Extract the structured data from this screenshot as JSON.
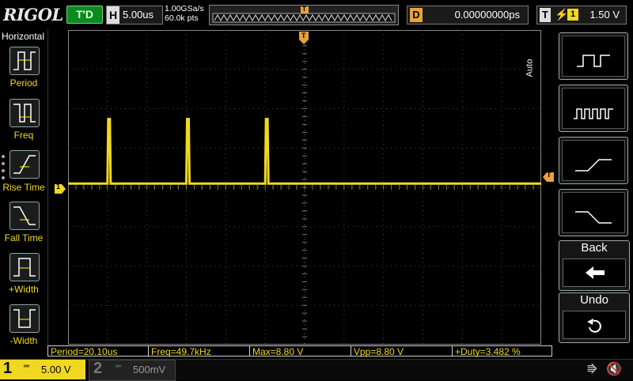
{
  "header": {
    "logo": "RIGOL",
    "run_status": "T'D",
    "horizontal": {
      "label": "H",
      "value": "5.00us"
    },
    "sample_rate": "1.00GSa/s",
    "memory_depth": "60.0k pts",
    "delay": {
      "label": "D",
      "value": "0.00000000ps"
    },
    "trigger": {
      "label": "T",
      "source": "1",
      "level": "1.50 V"
    },
    "trigger_marker": "T"
  },
  "left_panel": {
    "title": "Horizontal",
    "items": [
      {
        "label": "Period"
      },
      {
        "label": "Freq"
      },
      {
        "label": "Rise Time"
      },
      {
        "label": "Fall Time"
      },
      {
        "label": "+Width"
      },
      {
        "label": "-Width"
      }
    ]
  },
  "right_panel": {
    "mode_label": "Auto",
    "back_label": "Back",
    "undo_label": "Undo"
  },
  "waveform": {
    "channel_marker": "1",
    "trigger_level_marker": "T",
    "color": "#f0d820",
    "baseline_fraction": 0.488,
    "pulse_top_fraction": 0.283,
    "pulse_positions_div": [
      1.0,
      3.0,
      5.0
    ],
    "duty_fraction": 0.03482
  },
  "measurements": [
    {
      "text": "Period=20.10us"
    },
    {
      "text": "Freq=49.7kHz"
    },
    {
      "text": "Max=8.80 V"
    },
    {
      "text": "Vpp=8.80 V"
    },
    {
      "text": "+Duty=3.482 %"
    }
  ],
  "channels": {
    "ch1": {
      "number": "1",
      "coupling": "DC",
      "scale": "5.00 V",
      "color": "#f0d820"
    },
    "ch2": {
      "number": "2",
      "coupling": "DC",
      "scale": "500mV"
    }
  },
  "status_icons": {
    "usb": "usb-icon",
    "sound": "speaker-mute-icon"
  }
}
